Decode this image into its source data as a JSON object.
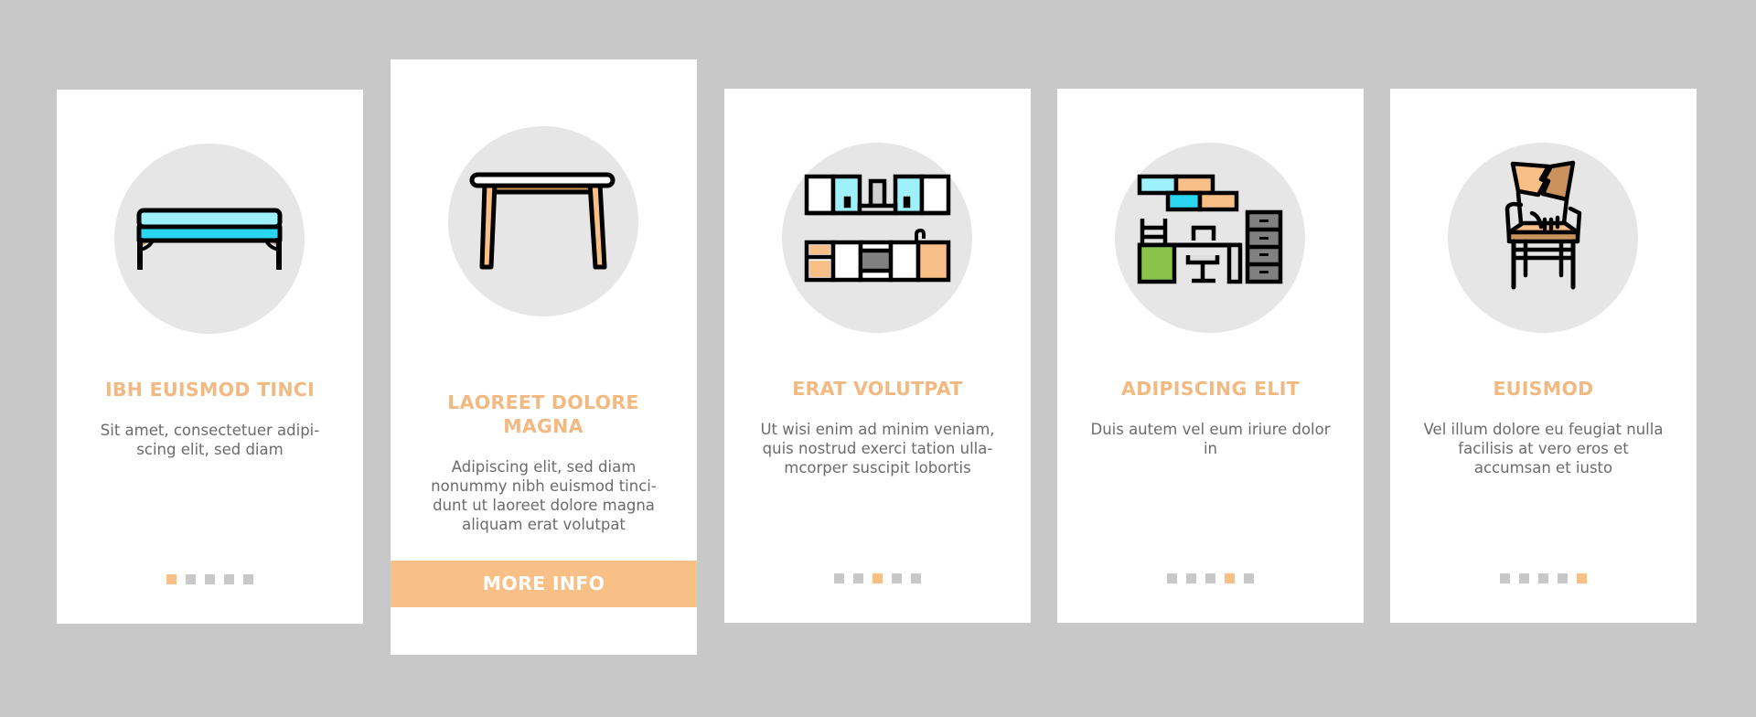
{
  "colors": {
    "background": "#c8c8c8",
    "card": "#ffffff",
    "circle": "#e6e6e6",
    "title": "#f2b982",
    "body_text": "#6b6b6b",
    "dot_inactive": "#c8c8c8",
    "dot_active": "#f8bf86",
    "button": "#f8bf86"
  },
  "cards": [
    {
      "icon": "bench-icon",
      "title": "IBH EUISMOD TINCI",
      "body": "Sit amet, consectetuer adipi- scing elit, sed diam",
      "active_dot": 1,
      "dot_count": 5
    },
    {
      "icon": "table-icon",
      "title": "LAOREET DOLORE MAGNA",
      "body": "Adipiscing elit, sed diam nonummy nibh euismod tinci- dunt ut laoreet dolore magna aliquam erat volutpat",
      "button_label": "MORE INFO"
    },
    {
      "icon": "kitchen-cabinets-icon",
      "title": "ERAT VOLUTPAT",
      "body": "Ut wisi enim ad minim veniam, quis nostrud exerci tation ulla- mcorper suscipit lobortis",
      "active_dot": 3,
      "dot_count": 5
    },
    {
      "icon": "office-desk-icon",
      "title": "ADIPISCING ELIT",
      "body": "Duis autem vel eum iriure dolor in",
      "active_dot": 4,
      "dot_count": 5
    },
    {
      "icon": "broken-chair-icon",
      "title": "EUISMOD",
      "body": "Vel illum dolore eu feugiat nulla facilisis at vero eros et accumsan et iusto",
      "active_dot": 5,
      "dot_count": 5
    }
  ]
}
